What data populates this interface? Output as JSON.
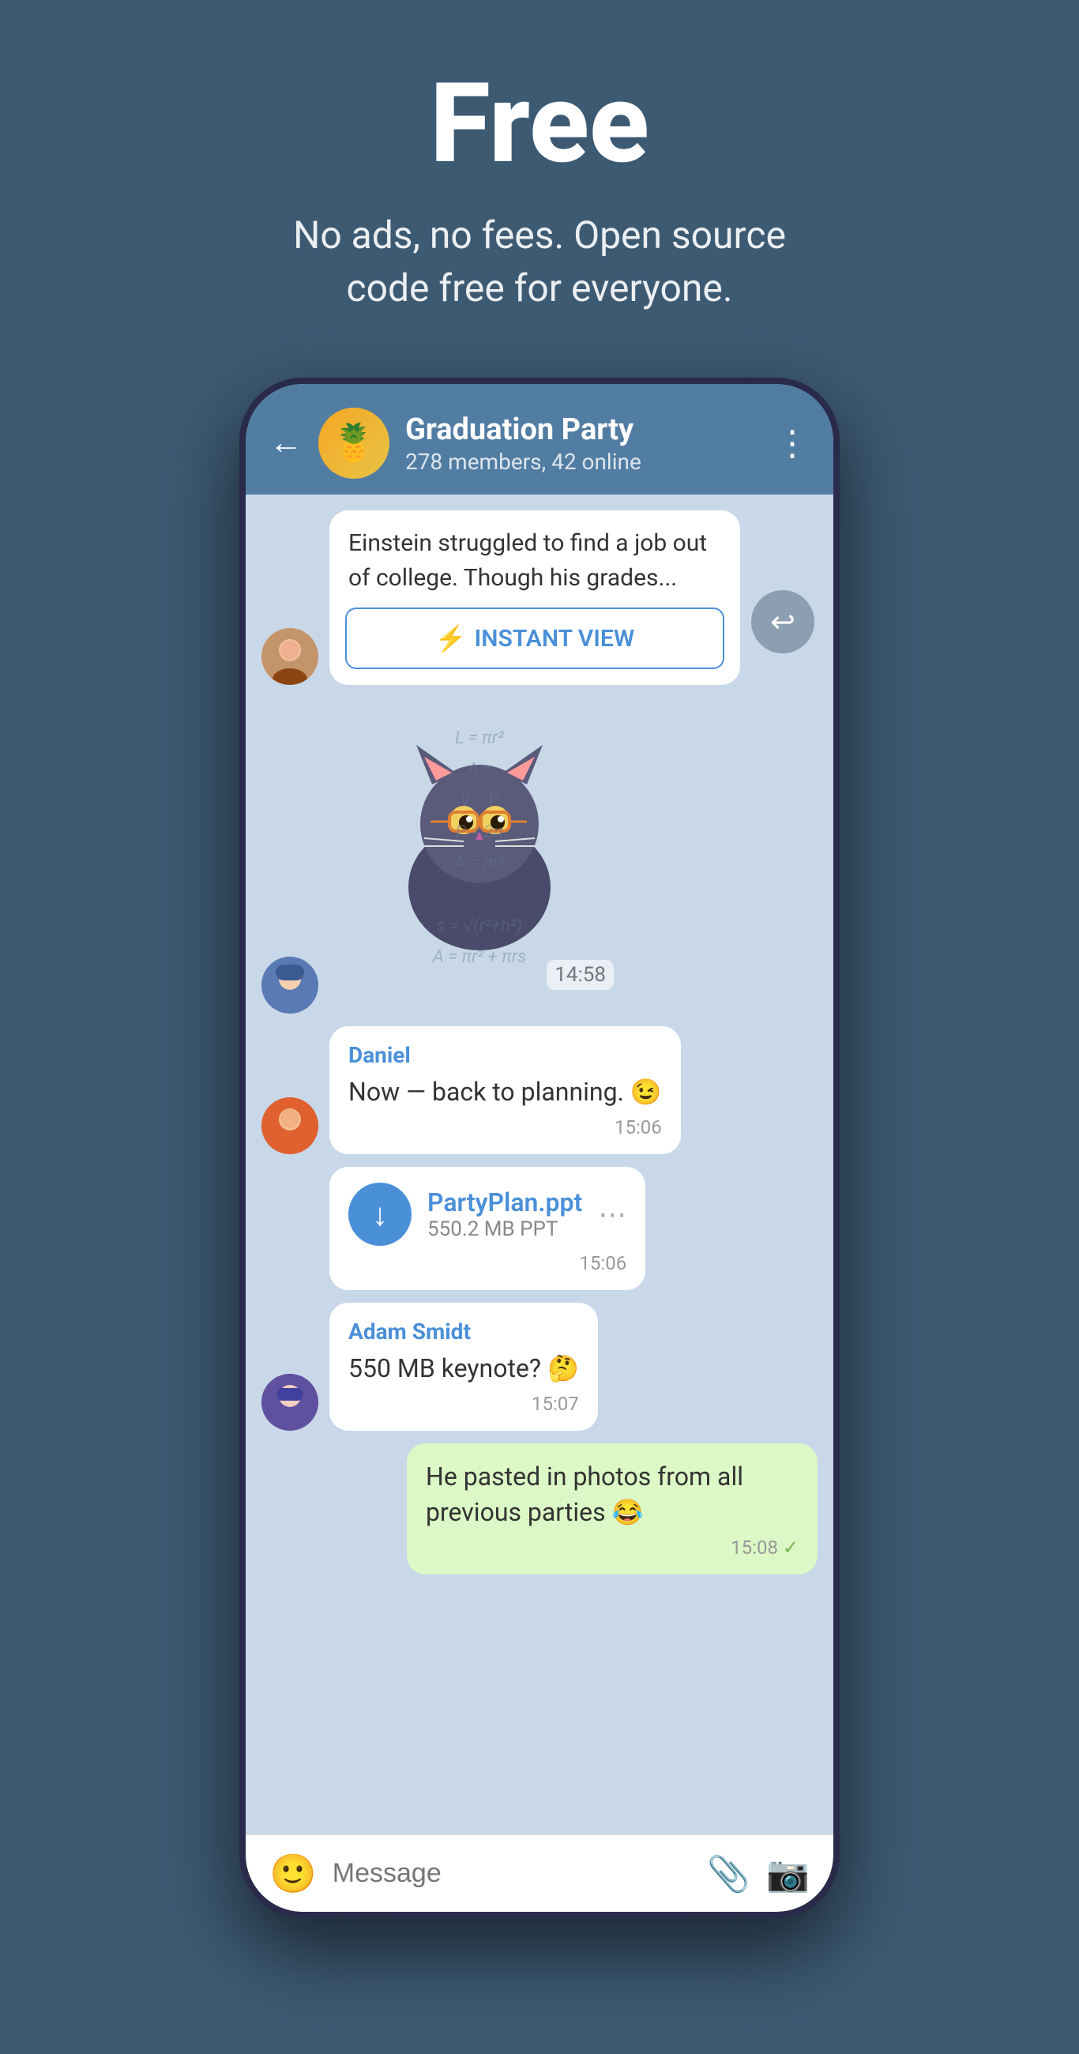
{
  "hero": {
    "title": "Free",
    "subtitle": "No ads, no fees. Open source code free for everyone."
  },
  "phone": {
    "header": {
      "back_label": "←",
      "group_name": "Graduation Party",
      "group_meta": "278 members, 42 online",
      "menu_label": "⋮",
      "group_emoji": "🍍"
    },
    "messages": [
      {
        "id": "article-msg",
        "type": "article",
        "avatar_type": "girl",
        "text": "Einstein struggled to find a job out of college. Though his grades...",
        "instant_view_label": "INSTANT VIEW"
      },
      {
        "id": "sticker-msg",
        "type": "sticker",
        "avatar_type": "boy1",
        "time": "14:58"
      },
      {
        "id": "daniel-msg",
        "type": "text",
        "avatar_type": "boy2",
        "sender": "Daniel",
        "text": "Now — back to planning. 😉",
        "time": "15:06"
      },
      {
        "id": "file-msg",
        "type": "file",
        "file_name": "PartyPlan.ppt",
        "file_size": "550.2 MB PPT",
        "time": "15:06"
      },
      {
        "id": "adam-msg",
        "type": "text",
        "avatar_type": "boy3",
        "sender": "Adam Smidt",
        "text": "550 MB keynote? 🤔",
        "time": "15:07"
      },
      {
        "id": "own-msg",
        "type": "own",
        "text": "He pasted in photos from all previous parties 😂",
        "time": "15:08"
      }
    ],
    "input_placeholder": "Message"
  },
  "colors": {
    "bg": "#3d5a73",
    "header_bg": "#527da3",
    "chat_bg": "#c8d8e8",
    "bubble_white": "#ffffff",
    "bubble_green": "#dcf8c6",
    "accent": "#4a90d9"
  }
}
